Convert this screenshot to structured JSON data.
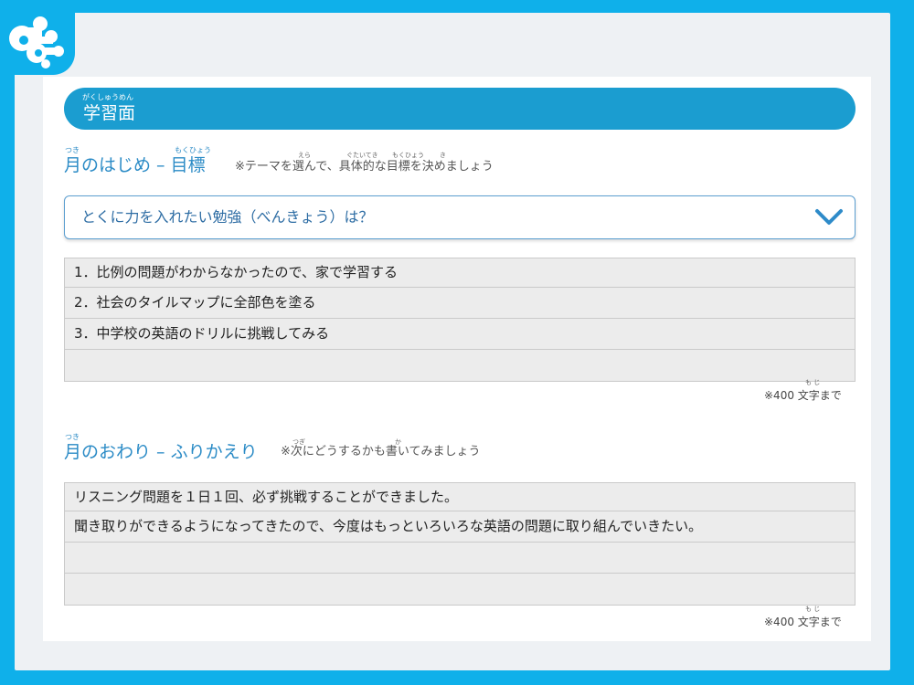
{
  "header": {
    "title": "学習面",
    "title_ruby": "がくしゅうめん"
  },
  "section_start": {
    "title": "月のはじめ – 目標",
    "ruby_tsuki": "つき",
    "ruby_mokuhyou": "もくひょう",
    "note": "※テーマを選んで、具体的な目標を決めましょう",
    "note_ruby_erabu": "えら",
    "note_ruby_gutaiteki": "ぐたいてき",
    "note_ruby_mokuhyou": "もくひょう",
    "note_ruby_kimeru": "き"
  },
  "dropdown": {
    "selected": "とくに力を入れたい勉強（べんきょう）は？"
  },
  "goal_list": {
    "items": [
      "1．比例の問題がわからなかったので、家で学習する",
      "2．社会のタイルマップに全部色を塗る",
      "3．中学校の英語のドリルに挑戦してみる",
      ""
    ],
    "counter": "※400 文字まで",
    "counter_ruby": "も じ"
  },
  "section_end": {
    "title": "月のおわり – ふりかえり",
    "ruby_tsuki": "つき",
    "note": "※次にどうするかも書いてみましょう",
    "note_ruby_tsugi": "つぎ",
    "note_ruby_kaku": "か"
  },
  "reflection_list": {
    "items": [
      "リスニング問題を１日１回、必ず挑戦することができました。",
      "聞き取りができるようになってきたので、今度はもっといろいろな英語の問題に取り組んでいきたい。",
      "",
      ""
    ],
    "counter": "※400 文字まで",
    "counter_ruby": "も じ"
  },
  "colors": {
    "frame": "#0fb0ea",
    "header_bar": "#1b9dd0",
    "accent_text": "#2b8bc6"
  }
}
